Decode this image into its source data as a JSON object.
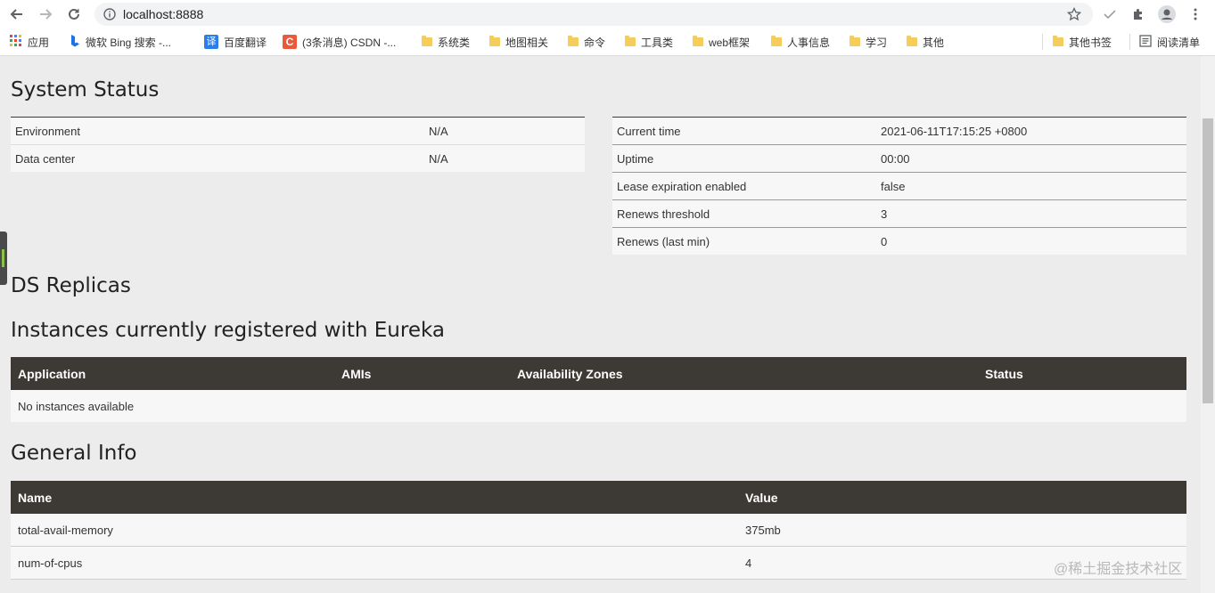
{
  "browser": {
    "url": "localhost:8888",
    "bookmarks": [
      {
        "label": "应用",
        "icon": "apps-grid-icon"
      },
      {
        "label": "微软 Bing 搜索 -...",
        "icon": "bing-icon"
      },
      {
        "label": "百度翻译",
        "icon": "translate-icon"
      },
      {
        "label": "(3条消息) CSDN -...",
        "icon": "csdn-icon"
      },
      {
        "label": "系统类",
        "icon": "folder-icon"
      },
      {
        "label": "地图相关",
        "icon": "folder-icon"
      },
      {
        "label": "命令",
        "icon": "folder-icon"
      },
      {
        "label": "工具类",
        "icon": "folder-icon"
      },
      {
        "label": "web框架",
        "icon": "folder-icon"
      },
      {
        "label": "人事信息",
        "icon": "folder-icon"
      },
      {
        "label": "学习",
        "icon": "folder-icon"
      },
      {
        "label": "其他",
        "icon": "folder-icon"
      },
      {
        "label": "其他书签",
        "icon": "folder-icon"
      },
      {
        "label": "阅读清单",
        "icon": "reading-list-icon"
      }
    ]
  },
  "system_status": {
    "title": "System Status",
    "left": [
      {
        "key": "Environment",
        "value": "N/A"
      },
      {
        "key": "Data center",
        "value": "N/A"
      }
    ],
    "right": [
      {
        "key": "Current time",
        "value": "2021-06-11T17:15:25 +0800"
      },
      {
        "key": "Uptime",
        "value": "00:00"
      },
      {
        "key": "Lease expiration enabled",
        "value": "false"
      },
      {
        "key": "Renews threshold",
        "value": "3"
      },
      {
        "key": "Renews (last min)",
        "value": "0"
      }
    ]
  },
  "ds_replicas": {
    "title": "DS Replicas"
  },
  "instances": {
    "title": "Instances currently registered with Eureka",
    "columns": [
      "Application",
      "AMIs",
      "Availability Zones",
      "Status"
    ],
    "empty_text": "No instances available"
  },
  "general_info": {
    "title": "General Info",
    "columns": [
      "Name",
      "Value"
    ],
    "rows": [
      {
        "name": "total-avail-memory",
        "value": "375mb"
      },
      {
        "name": "num-of-cpus",
        "value": "4"
      }
    ]
  },
  "watermark": "@稀土掘金技术社区"
}
